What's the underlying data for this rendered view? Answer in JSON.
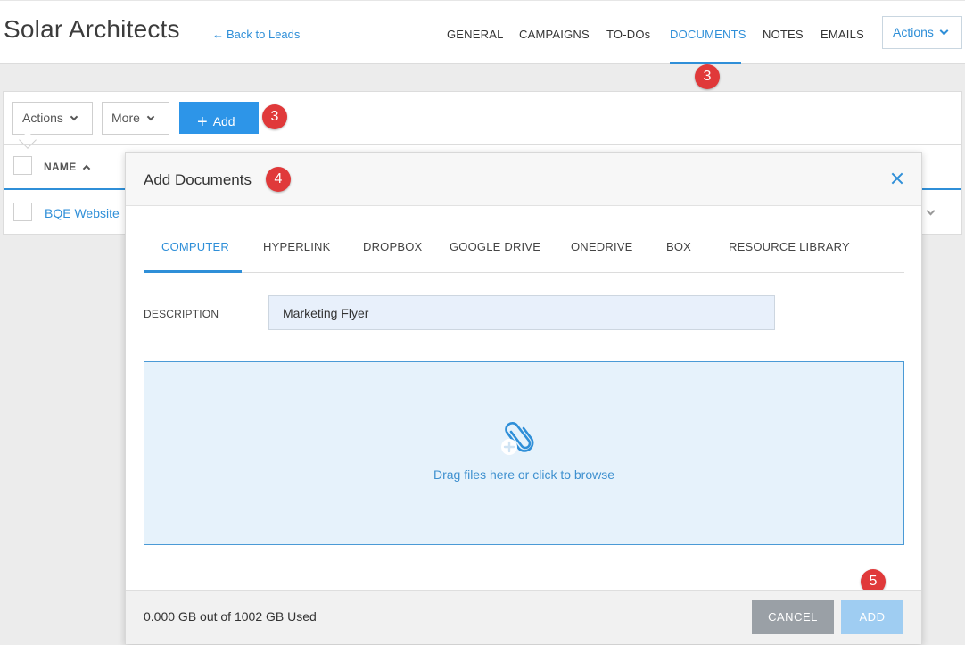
{
  "header": {
    "title": "Solar Architects",
    "back_link": "Back to Leads",
    "back_arrow": "←",
    "tabs": [
      {
        "label": "GENERAL"
      },
      {
        "label": "CAMPAIGNS"
      },
      {
        "label": "TO-DOs"
      },
      {
        "label": "DOCUMENTS"
      },
      {
        "label": "NOTES"
      },
      {
        "label": "EMAILS"
      }
    ],
    "active_tab": "DOCUMENTS",
    "actions_label": "Actions"
  },
  "badges": {
    "documents_tab": "3",
    "add_button": "3",
    "modal_title": "4",
    "add_doc_button": "5"
  },
  "toolbar": {
    "actions_label": "Actions",
    "more_label": "More",
    "add_label": "Add",
    "add_icon": "+"
  },
  "list": {
    "column_name": "NAME",
    "rows": [
      {
        "name": "BQE Website"
      }
    ]
  },
  "modal": {
    "title": "Add Documents",
    "tabs": [
      {
        "label": "COMPUTER"
      },
      {
        "label": "HYPERLINK"
      },
      {
        "label": "DROPBOX"
      },
      {
        "label": "GOOGLE DRIVE"
      },
      {
        "label": "ONEDRIVE"
      },
      {
        "label": "BOX"
      },
      {
        "label": "RESOURCE LIBRARY"
      }
    ],
    "active_tab": "COMPUTER",
    "description_label": "DESCRIPTION",
    "description_value": "Marketing Flyer",
    "dropzone_text": "Drag files here or click to browse",
    "dropzone_icon": "paperclip-add-icon",
    "usage_text": "0.000 GB out of 1002 GB Used",
    "cancel_label": "CANCEL",
    "add_label": "ADD"
  },
  "colors": {
    "accent": "#2f8fd8",
    "primary_button": "#2d95e8",
    "badge": "#e0393a",
    "disabled_add": "#9fcdf2",
    "cancel": "#9aa0a6",
    "dropzone_bg": "#e6f2fb"
  }
}
